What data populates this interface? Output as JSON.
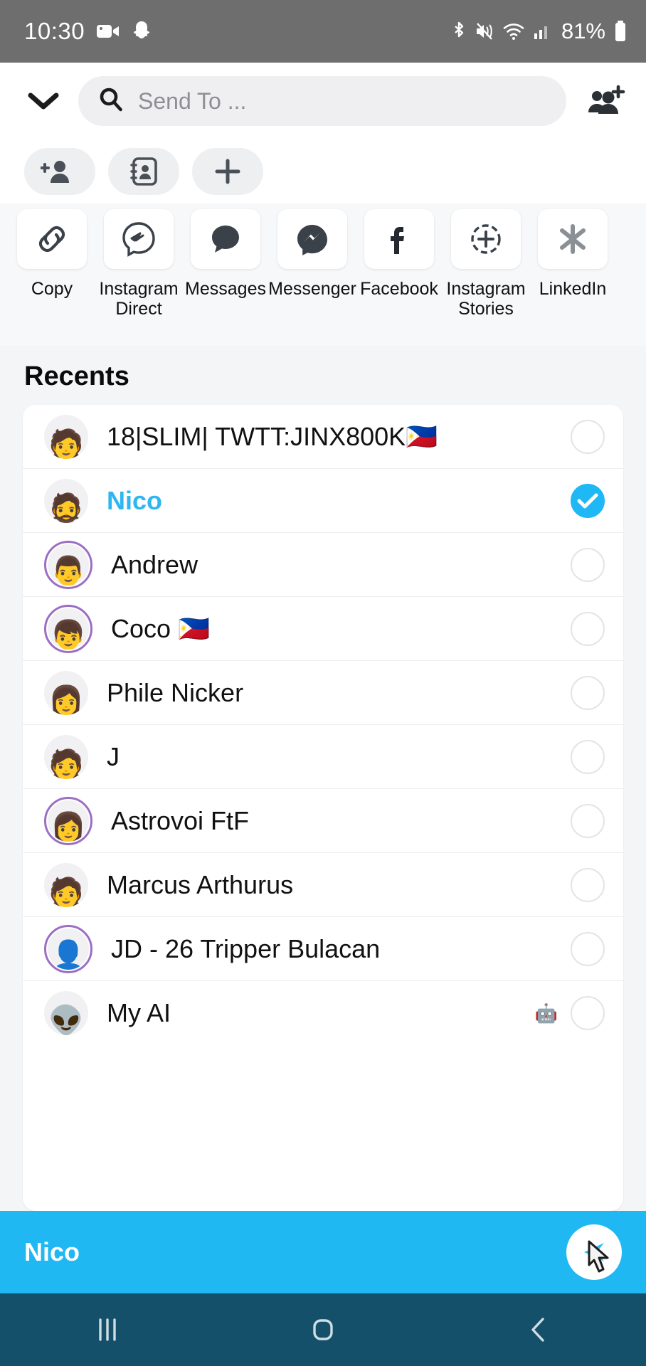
{
  "statusbar": {
    "time": "10:30",
    "battery_pct": "81%",
    "icons_left": [
      "video-camera-icon",
      "snapchat-ghost-icon"
    ],
    "icons_right": [
      "bluetooth-icon",
      "mute-icon",
      "wifi-icon",
      "cellular-signal-icon",
      "battery-icon"
    ]
  },
  "header": {
    "collapse_icon": "chevron-down-icon",
    "search_icon": "search-icon",
    "search_placeholder": "Send To ...",
    "search_value": "",
    "add_group_icon": "add-group-icon"
  },
  "chips": [
    {
      "name": "add-friend-chip",
      "icon": "add-person-icon"
    },
    {
      "name": "contact-book-chip",
      "icon": "contact-book-icon"
    },
    {
      "name": "new-chip",
      "icon": "plus-icon"
    }
  ],
  "share_targets": [
    {
      "label": "Copy",
      "icon": "link-icon"
    },
    {
      "label": "Instagram Direct",
      "icon": "instagram-direct-icon"
    },
    {
      "label": "Messages",
      "icon": "speech-bubble-icon"
    },
    {
      "label": "Messenger",
      "icon": "messenger-icon"
    },
    {
      "label": "Facebook",
      "icon": "facebook-icon"
    },
    {
      "label": "Instagram Stories",
      "icon": "instagram-stories-icon"
    },
    {
      "label": "LinkedIn",
      "icon": "linkedin-icon"
    }
  ],
  "recents": {
    "title": "Recents",
    "rows": [
      {
        "name": "18|SLIM| TWTT:JINX800K🇵🇭",
        "selected": false,
        "ring": false,
        "badge": "",
        "avatar": "🧑"
      },
      {
        "name": "Nico",
        "selected": true,
        "ring": false,
        "badge": "",
        "avatar": "🧔"
      },
      {
        "name": "Andrew",
        "selected": false,
        "ring": true,
        "badge": "",
        "avatar": "👨"
      },
      {
        "name": "Coco 🇵🇭",
        "selected": false,
        "ring": true,
        "badge": "",
        "avatar": "👦"
      },
      {
        "name": "Phile Nicker",
        "selected": false,
        "ring": false,
        "badge": "",
        "avatar": "👩"
      },
      {
        "name": "J",
        "selected": false,
        "ring": false,
        "badge": "",
        "avatar": "🧑"
      },
      {
        "name": "Astrovoi FtF",
        "selected": false,
        "ring": true,
        "badge": "",
        "avatar": "👩"
      },
      {
        "name": "Marcus Arthurus",
        "selected": false,
        "ring": false,
        "badge": "",
        "avatar": "🧑"
      },
      {
        "name": "JD - 26 Tripper Bulacan",
        "selected": false,
        "ring": true,
        "badge": "",
        "avatar": "👤"
      },
      {
        "name": "My AI",
        "selected": false,
        "ring": false,
        "badge": "🤖",
        "avatar": "👽"
      }
    ]
  },
  "sendbar": {
    "selected_names": "Nico",
    "send_icon": "send-arrow-icon",
    "cursor_icon": "mouse-cursor-icon"
  },
  "navbar": [
    {
      "name": "nav-recents-button",
      "icon": "recents-icon"
    },
    {
      "name": "nav-home-button",
      "icon": "home-icon"
    },
    {
      "name": "nav-back-button",
      "icon": "back-chevron-icon"
    }
  ],
  "colors": {
    "accent_blue": "#1EB8F5",
    "sendbar_blue": "#20B8F3",
    "navbar": "#15506B",
    "statusbar": "#6E6E6E",
    "story_ring": "#9B6FC4"
  }
}
